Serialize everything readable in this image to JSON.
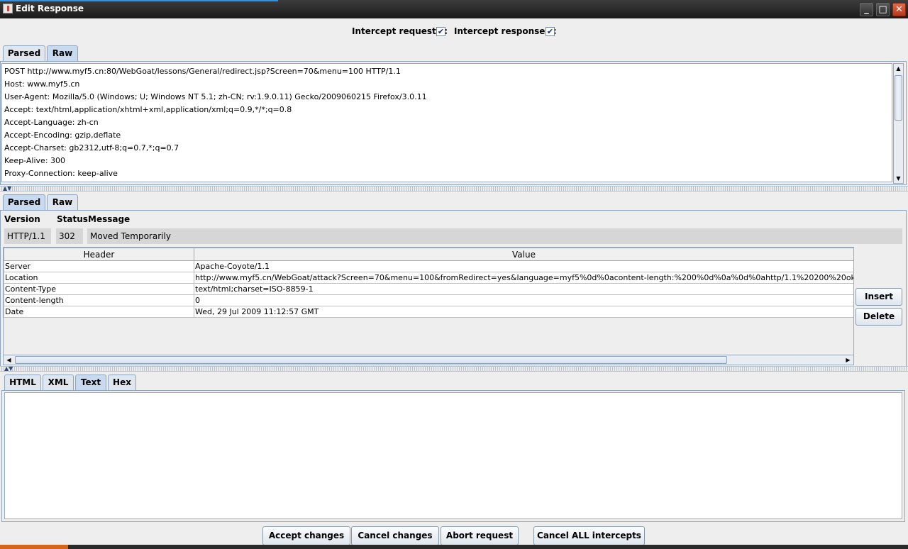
{
  "window": {
    "title": "Edit Response"
  },
  "intercept": {
    "requests_label": "Intercept requests :",
    "requests_checked": true,
    "responses_label": "Intercept responses :",
    "responses_checked": true,
    "check_glyph": "✔"
  },
  "request_tabs": [
    {
      "label": "Parsed",
      "selected": false
    },
    {
      "label": "Raw",
      "selected": true
    }
  ],
  "request_raw_lines": [
    "POST http://www.myf5.cn:80/WebGoat/lessons/General/redirect.jsp?Screen=70&menu=100 HTTP/1.1",
    "Host: www.myf5.cn",
    "User-Agent: Mozilla/5.0 (Windows; U; Windows NT 5.1; zh-CN; rv:1.9.0.11) Gecko/2009060215 Firefox/3.0.11",
    "Accept: text/html,application/xhtml+xml,application/xml;q=0.9,*/*;q=0.8",
    "Accept-Language: zh-cn",
    "Accept-Encoding: gzip,deflate",
    "Accept-Charset: gb2312,utf-8;q=0.7,*;q=0.7",
    "Keep-Alive: 300",
    "Proxy-Connection: keep-alive"
  ],
  "response_tabs": [
    {
      "label": "Parsed",
      "selected": true
    },
    {
      "label": "Raw",
      "selected": false
    }
  ],
  "status_line": {
    "version_label": "Version",
    "status_label": "Status",
    "message_label": "Message",
    "version": "HTTP/1.1",
    "status": "302",
    "message": "Moved Temporarily"
  },
  "headers_table": {
    "columns": [
      "Header",
      "Value"
    ],
    "rows": [
      [
        "Server",
        "Apache-Coyote/1.1"
      ],
      [
        "Location",
        "http://www.myf5.cn/WebGoat/attack?Screen=70&menu=100&fromRedirect=yes&language=myf5%0d%0acontent-length:%200%0d%0a%0d%0ahttp/1.1%20200%20ok%0"
      ],
      [
        "Content-Type",
        "text/html;charset=ISO-8859-1"
      ],
      [
        "Content-length",
        "0"
      ],
      [
        "Date",
        "Wed, 29 Jul 2009 11:12:57 GMT"
      ]
    ]
  },
  "table_buttons": {
    "insert": "Insert",
    "delete": "Delete"
  },
  "body_tabs": [
    {
      "label": "HTML",
      "selected": false
    },
    {
      "label": "XML",
      "selected": false
    },
    {
      "label": "Text",
      "selected": true
    },
    {
      "label": "Hex",
      "selected": false
    }
  ],
  "body_text": "",
  "actions": {
    "accept": "Accept changes",
    "cancel": "Cancel changes",
    "abort": "Abort request",
    "cancel_all": "Cancel ALL intercepts"
  },
  "icons": {
    "minimize": "minimize-icon",
    "maximize": "maximize-icon",
    "close": "close-icon",
    "scroll_up": "arrow-up-icon",
    "scroll_down": "arrow-down-icon",
    "scroll_left": "arrow-left-icon",
    "scroll_right": "arrow-right-icon"
  },
  "colors": {
    "titlebar": "#2a2a2a",
    "tab_selected": "#c8daf0",
    "close_button": "#c8482a"
  }
}
